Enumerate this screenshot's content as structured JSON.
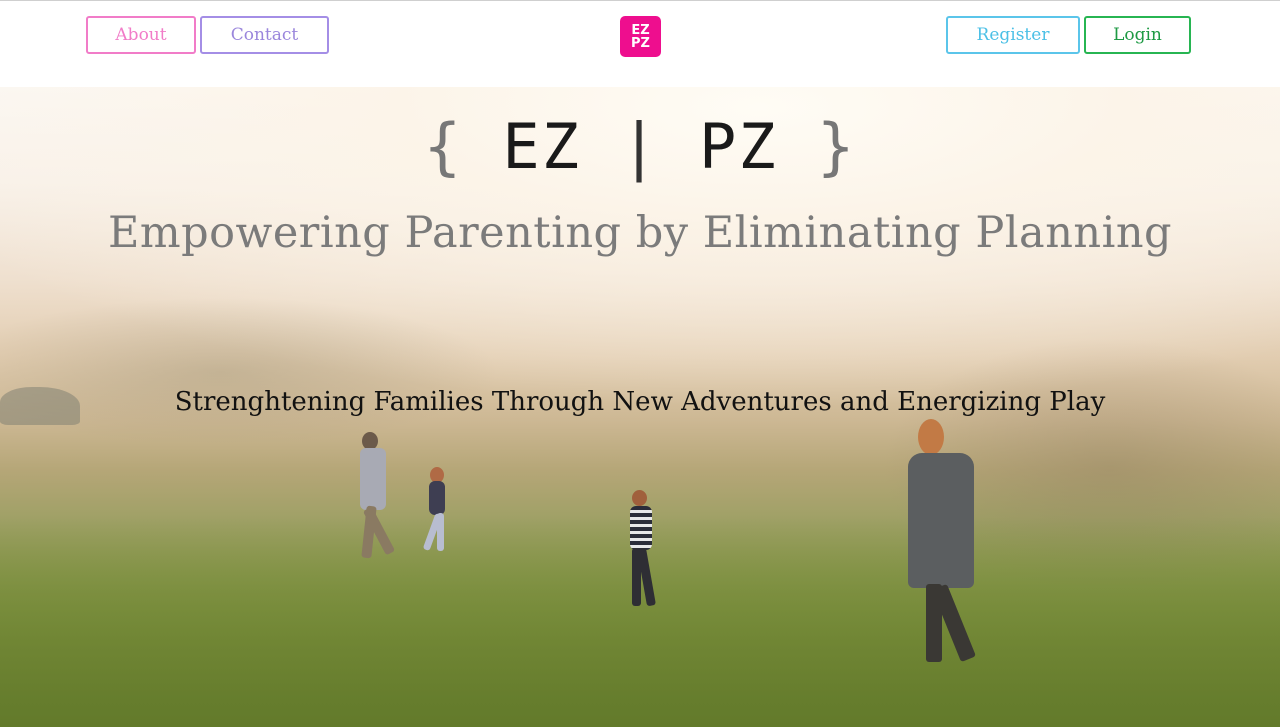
{
  "nav": {
    "about_label": "About",
    "contact_label": "Contact",
    "register_label": "Register",
    "login_label": "Login",
    "colors": {
      "about": "#f17cc8",
      "contact": "#a48ee6",
      "register": "#5bc5ea",
      "login": "#27b552"
    }
  },
  "logo": {
    "line1": "EZ",
    "line2": "PZ",
    "color": "#ee0e8e"
  },
  "hero": {
    "brace_open": "{",
    "word_left": "EZ",
    "separator": "|",
    "word_right": "PZ",
    "brace_close": "}",
    "tagline": "Empowering Parenting by Eliminating Planning",
    "subtagline": "Strenghtening Families Through New Adventures and Energizing Play",
    "background_image": "family-walking-in-foggy-meadow"
  }
}
